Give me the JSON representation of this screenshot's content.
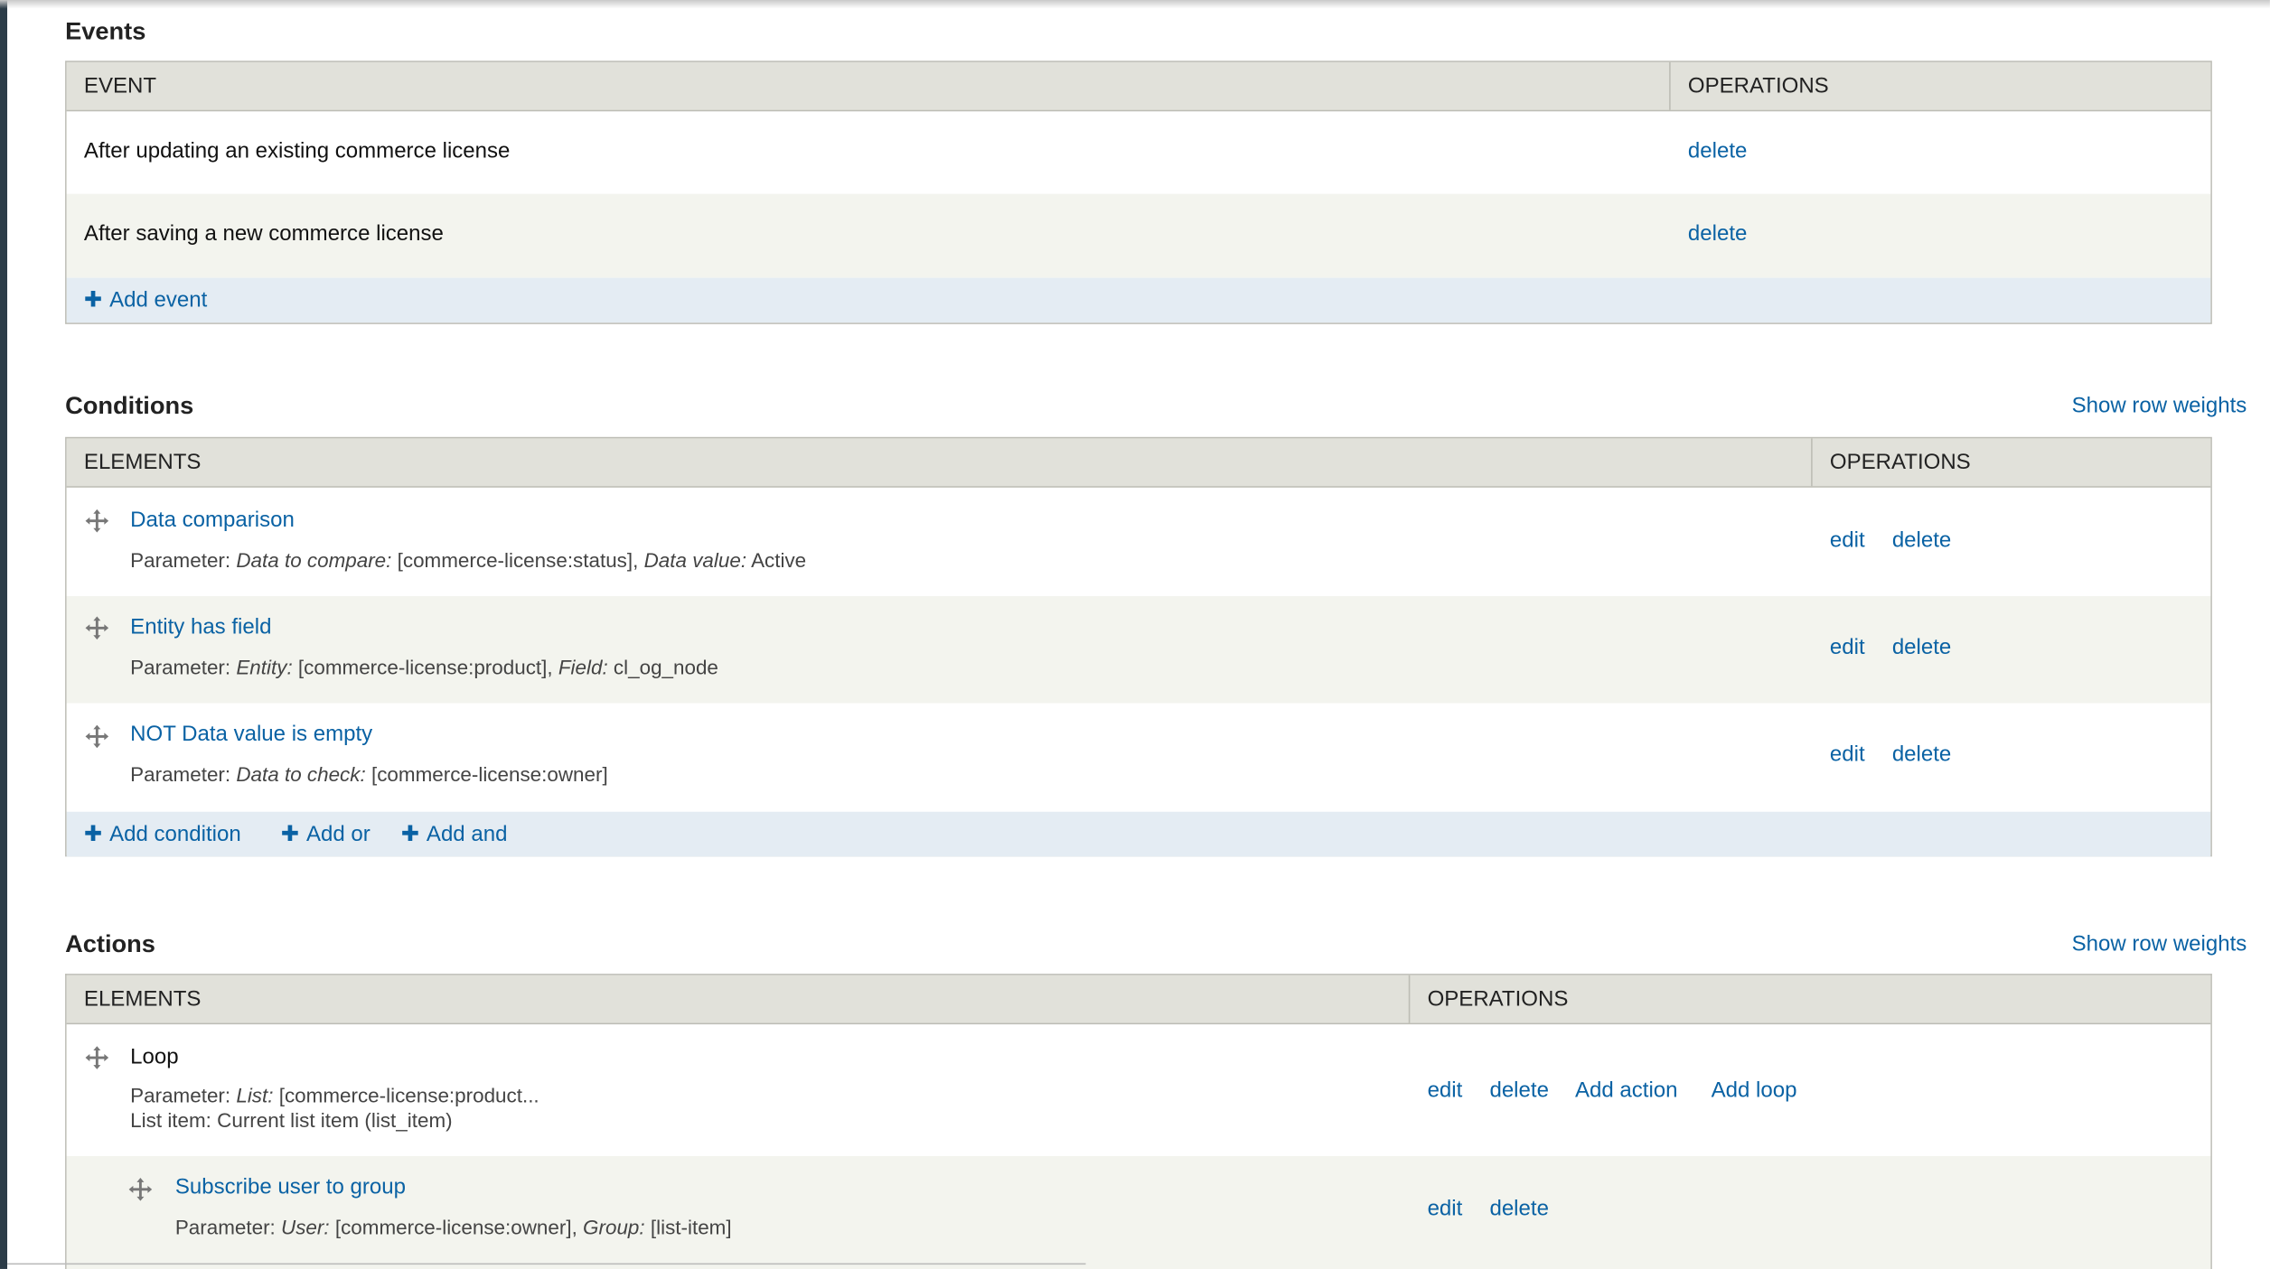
{
  "events": {
    "title": "Events",
    "columns": {
      "event": "EVENT",
      "operations": "OPERATIONS"
    },
    "rows": [
      {
        "label": "After updating an existing commerce license",
        "op": "delete"
      },
      {
        "label": "After saving a new commerce license",
        "op": "delete"
      }
    ],
    "add_label": "Add event"
  },
  "conditions": {
    "title": "Conditions",
    "row_weights": "Show row weights",
    "columns": {
      "elements": "ELEMENTS",
      "operations": "OPERATIONS"
    },
    "rows": [
      {
        "title": "Data comparison",
        "param_prefix": "Parameter:",
        "k1": "Data to compare:",
        "v1": "[commerce-license:status],",
        "k2": "Data value:",
        "v2": "Active",
        "edit": "edit",
        "delete": "delete"
      },
      {
        "title": "Entity has field",
        "param_prefix": "Parameter:",
        "k1": "Entity:",
        "v1": "[commerce-license:product],",
        "k2": "Field:",
        "v2": "cl_og_node",
        "edit": "edit",
        "delete": "delete"
      },
      {
        "title": "NOT Data value is empty",
        "param_prefix": "Parameter:",
        "k1": "Data to check:",
        "v1": "[commerce-license:owner]",
        "edit": "edit",
        "delete": "delete"
      }
    ],
    "add_condition": "Add condition",
    "add_or": "Add or",
    "add_and": "Add and"
  },
  "actions": {
    "title": "Actions",
    "row_weights": "Show row weights",
    "columns": {
      "elements": "ELEMENTS",
      "operations": "OPERATIONS"
    },
    "rows": [
      {
        "title": "Loop",
        "param_prefix": "Parameter:",
        "k1": "List:",
        "v1": "[commerce-license:product...",
        "line2": "List item: Current list item (list_item)",
        "edit": "edit",
        "delete": "delete",
        "add_action": "Add action",
        "add_loop": "Add loop"
      },
      {
        "title": "Subscribe user to group",
        "param_prefix": "Parameter:",
        "k1": "User:",
        "v1": "[commerce-license:owner],",
        "k2": "Group:",
        "v2": "[list-item]",
        "edit": "edit",
        "delete": "delete"
      }
    ]
  },
  "colors": {
    "link": "#0a62a4",
    "header_bg": "#e1e1da",
    "footer_bg": "#e4ecf3",
    "even_row": "#f3f4ee"
  },
  "icons": {
    "drag": "drag-handle-icon",
    "add": "plus-icon"
  }
}
